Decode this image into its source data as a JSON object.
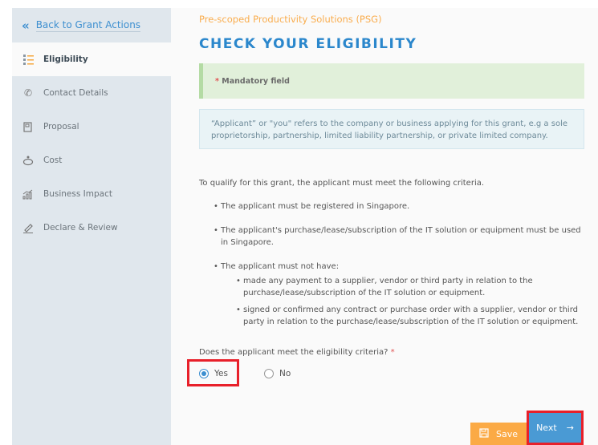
{
  "sidebar": {
    "back_label": "Back to Grant Actions",
    "items": [
      {
        "label": "Eligibility",
        "icon": "list-icon",
        "active": true
      },
      {
        "label": "Contact Details",
        "icon": "phone-icon"
      },
      {
        "label": "Proposal",
        "icon": "document-icon"
      },
      {
        "label": "Cost",
        "icon": "piggy-bank-icon"
      },
      {
        "label": "Business Impact",
        "icon": "bar-chart-icon"
      },
      {
        "label": "Declare & Review",
        "icon": "pen-icon"
      }
    ]
  },
  "main": {
    "subtitle": "Pre-scoped Productivity Solutions (PSG)",
    "title": "CHECK YOUR ELIGIBILITY",
    "mandatory_asterisk": "*",
    "mandatory_label": "Mandatory field",
    "info": "“Applicant” or \"you\" refers to the company or business applying for this grant, e.g a sole proprietorship, partnership, limited liability partnership, or private limited company.",
    "criteria_intro": "To qualify for this grant, the applicant must meet the following criteria.",
    "criteria": [
      "The applicant must be registered in Singapore.",
      "The applicant's purchase/lease/subscription of the IT solution or equipment must be used in Singapore.",
      "The applicant must not have:"
    ],
    "sub_criteria": [
      "made any payment to a supplier, vendor or third party in relation to the purchase/lease/subscription of the IT solution or equipment.",
      "signed or confirmed any contract or purchase order with a supplier, vendor or third party in relation to the purchase/lease/subscription of the IT solution or equipment."
    ],
    "question": "Does the applicant meet the eligibility criteria?",
    "question_asterisk": "*",
    "options": [
      {
        "label": "Yes",
        "selected": true
      },
      {
        "label": "No",
        "selected": false
      }
    ],
    "save_label": "Save",
    "next_label": "Next"
  },
  "colors": {
    "accent": "#2b87cc",
    "orange": "#fbaa45",
    "next": "#4a9ad4",
    "highlight": "#e8202a"
  }
}
